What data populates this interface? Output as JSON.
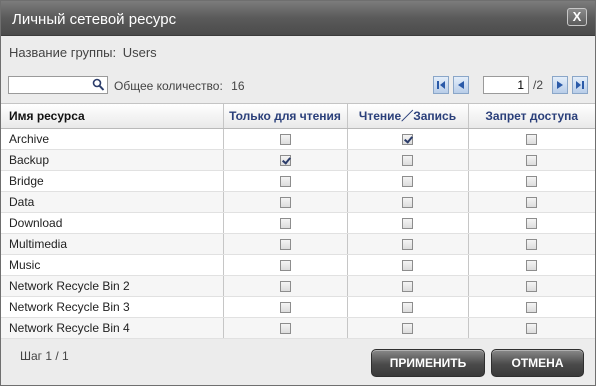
{
  "dialog": {
    "title": "Личный сетевой ресурс",
    "close_label": "X"
  },
  "group": {
    "label": "Название группы:",
    "value": "Users"
  },
  "search": {
    "value": "",
    "placeholder": ""
  },
  "total": {
    "label": "Общее количество:",
    "value": "16"
  },
  "pager": {
    "current_page": "1",
    "total_pages": "/2"
  },
  "table": {
    "columns": [
      "Имя ресурса",
      "Только для чтения",
      "Чтение／Запись",
      "Запрет доступа"
    ],
    "rows": [
      {
        "name": "Archive",
        "read_only": false,
        "read_write": true,
        "deny": false
      },
      {
        "name": "Backup",
        "read_only": true,
        "read_write": false,
        "deny": false
      },
      {
        "name": "Bridge",
        "read_only": false,
        "read_write": false,
        "deny": false
      },
      {
        "name": "Data",
        "read_only": false,
        "read_write": false,
        "deny": false
      },
      {
        "name": "Download",
        "read_only": false,
        "read_write": false,
        "deny": false
      },
      {
        "name": "Multimedia",
        "read_only": false,
        "read_write": false,
        "deny": false
      },
      {
        "name": "Music",
        "read_only": false,
        "read_write": false,
        "deny": false
      },
      {
        "name": "Network Recycle Bin 2",
        "read_only": false,
        "read_write": false,
        "deny": false
      },
      {
        "name": "Network Recycle Bin 3",
        "read_only": false,
        "read_write": false,
        "deny": false
      },
      {
        "name": "Network Recycle Bin 4",
        "read_only": false,
        "read_write": false,
        "deny": false
      }
    ]
  },
  "footer": {
    "step": "Шаг 1 / 1",
    "apply_label": "ПРИМЕНИТЬ",
    "cancel_label": "ОТМЕНА"
  },
  "colors": {
    "titlebar": "#5a5a5a",
    "header_text": "#2a3f7a",
    "pager_button": "#b8cde8",
    "button": "#4a4a4a"
  },
  "icons": {
    "search": "magnifier-icon",
    "pager": [
      "first-page-icon",
      "prev-page-icon",
      "next-page-icon",
      "last-page-icon"
    ]
  }
}
